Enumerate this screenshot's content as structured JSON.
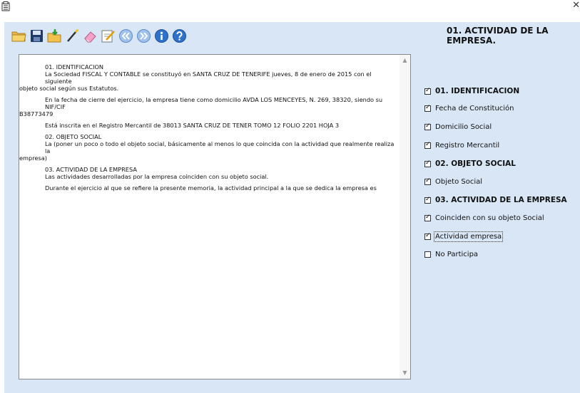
{
  "section_title": "01. ACTIVIDAD DE LA EMPRESA.",
  "toolbar": {
    "buttons": [
      "open-folder-icon",
      "save-icon",
      "import-icon",
      "wand-icon",
      "eraser-icon",
      "edit-icon",
      "previous-icon",
      "next-icon",
      "info-icon",
      "help-icon"
    ]
  },
  "document": {
    "p1_title": "01. IDENTIFICACION",
    "p1_line1": "La Sociedad FISCAL Y CONTABLE se constituyó en SANTA CRUZ DE TENERIFE jueves, 8 de enero de 2015 con el siguiente",
    "p1_line2": "objeto social según sus Estatutos.",
    "p2_line1": "En la fecha de cierre del ejercicio, la empresa tiene como domicilio AVDA LOS MENCEYES, N. 269, 38320, siendo su NIF/CIF",
    "p2_line2": "B38773479",
    "p3": "Está inscrita en el Registro Mercantil de 38013 SANTA CRUZ DE TENER TOMO 12 FOLIO 2201 HOJA 3",
    "p4_title": "02. OBJETO SOCIAL",
    "p4_line1": "La (poner un poco o todo el objeto social, básicamente al menos lo que coincida con la actividad que realmente realiza la",
    "p4_line2": "empresa)",
    "p5_title": "03. ACTIVIDAD DE LA EMPRESA",
    "p5_line1": "Las actividades desarrolladas por la empresa coinciden con su objeto social.",
    "p6": "Durante el ejercicio al que se refiere la presente memoria, la actividad principal a la que se dedica la empresa es"
  },
  "checklist": [
    {
      "label": "01. IDENTIFICACION",
      "checked": true,
      "bold": true
    },
    {
      "label": "Fecha de Constitución",
      "checked": true,
      "bold": false
    },
    {
      "label": "Domicilio Social",
      "checked": true,
      "bold": false
    },
    {
      "label": "Registro Mercantil",
      "checked": true,
      "bold": false
    },
    {
      "label": "02. OBJETO SOCIAL",
      "checked": true,
      "bold": true
    },
    {
      "label": "Objeto Social",
      "checked": true,
      "bold": false
    },
    {
      "label": "03. ACTIVIDAD DE LA EMPRESA",
      "checked": true,
      "bold": true
    },
    {
      "label": "Coinciden con su objeto Social",
      "checked": true,
      "bold": false
    },
    {
      "label": "Actividad empresa",
      "checked": true,
      "bold": false
    },
    {
      "label": "No Participa",
      "checked": false,
      "bold": false
    }
  ]
}
